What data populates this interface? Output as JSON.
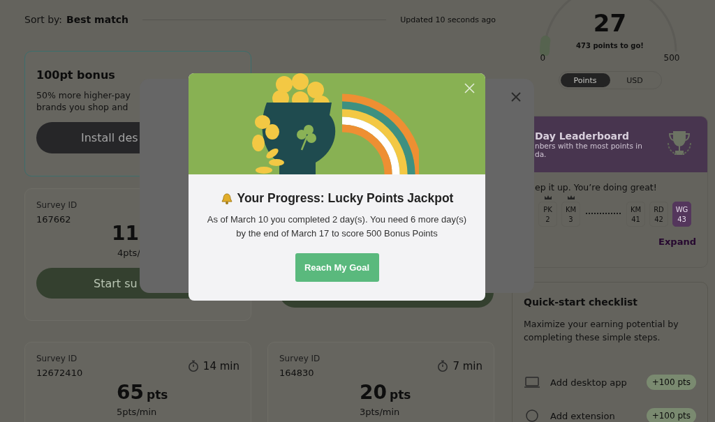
{
  "sort": {
    "label": "Sort by:",
    "value": "Best match",
    "updated": "Updated 10 seconds ago"
  },
  "promo": {
    "title": "100pt bonus",
    "lines": [
      "50% more higher-pay",
      "brands you shop and"
    ],
    "button": "Install des"
  },
  "surveys": [
    {
      "kind": "partial",
      "id_label": "Survey ID",
      "id": "167662",
      "points": "11",
      "rate": "4pts/",
      "button": "Start su"
    },
    {
      "kind": "covered"
    },
    {
      "kind": "full",
      "id_label": "Survey ID",
      "id": "12672410",
      "duration": "14 min",
      "points": "65",
      "unit": "pts",
      "rate": "5pts/min"
    },
    {
      "kind": "full",
      "id_label": "Survey ID",
      "id": "164830",
      "duration": "7 min",
      "points": "20",
      "unit": "pts",
      "rate": "3pts/min"
    }
  ],
  "goal": {
    "value": "27",
    "caption": "473 points to go!",
    "min": "0",
    "max": "500",
    "level": 0.054,
    "units": [
      {
        "label": "Points",
        "selected": true
      },
      {
        "label": "USD",
        "selected": false
      }
    ]
  },
  "leaderboard": {
    "title": "Day Leaderboard",
    "subtitle": [
      "nbers with the most points in",
      "da."
    ],
    "message": "ep it up. You’re doing great!",
    "members": [
      {
        "kind": "cut"
      },
      {
        "kind": "member",
        "initials": "PK",
        "rank": "2",
        "crowned": true,
        "selected": false
      },
      {
        "kind": "member",
        "initials": "KM",
        "rank": "3",
        "crowned": true,
        "selected": false
      },
      {
        "kind": "gap"
      },
      {
        "kind": "member",
        "initials": "KM",
        "rank": "41",
        "crowned": false,
        "selected": false
      },
      {
        "kind": "member",
        "initials": "RD",
        "rank": "42",
        "crowned": false,
        "selected": false
      },
      {
        "kind": "member",
        "initials": "WG",
        "rank": "43",
        "crowned": false,
        "selected": true
      }
    ],
    "link": "Expand"
  },
  "checklist": {
    "title": "Quick-start checklist",
    "text": "Maximize your earning potential by completing these simple steps.",
    "items": [
      {
        "kind": "desktop",
        "label": "Add desktop app",
        "reward": "+100 pts"
      },
      {
        "kind": "extension",
        "label": "Add extension",
        "reward": "+100 pts"
      }
    ]
  },
  "dialog": {
    "title": "Your Progress: Lucky Points Jackpot",
    "text": "As of March 10 you completed 2 day(s). You need 6 more day(s) by the end of March 17 to score 500 Bonus Points",
    "button": "Reach My Goal"
  }
}
